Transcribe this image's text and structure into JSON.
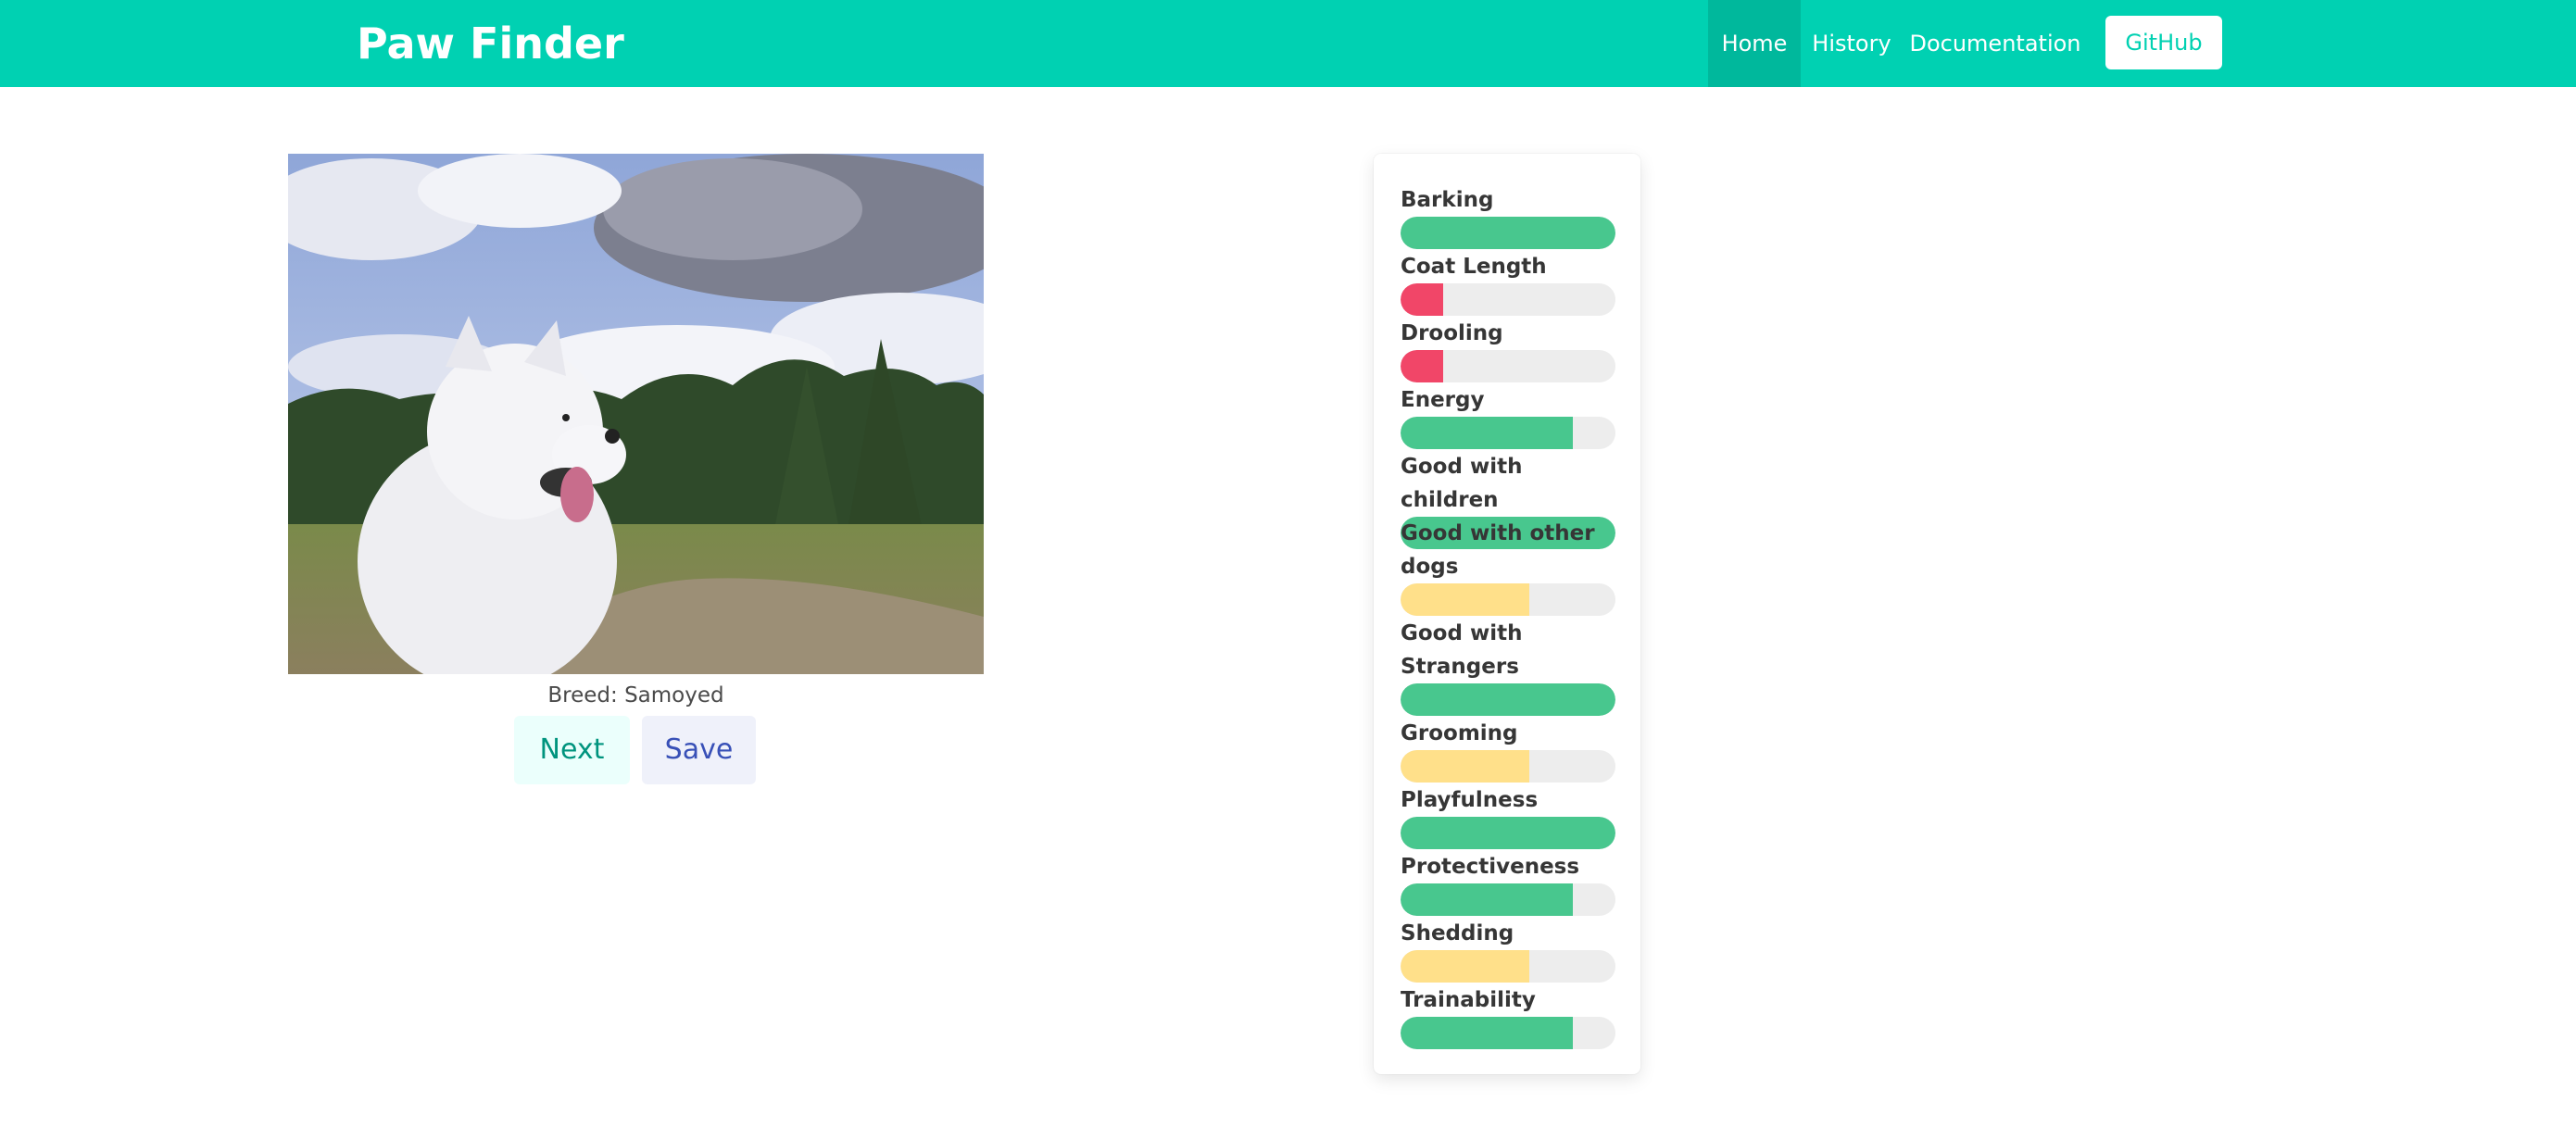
{
  "navbar": {
    "brand": "Paw Finder",
    "items": [
      {
        "label": "Home"
      },
      {
        "label": "History"
      },
      {
        "label": "Documentation"
      }
    ],
    "github_label": "GitHub",
    "color": "#00d1b2"
  },
  "main": {
    "breed_text": "Breed: Samoyed",
    "next_label": "Next",
    "save_label": "Save"
  },
  "traits": [
    {
      "label": "Barking",
      "value": 1.0,
      "color": "#48c78e"
    },
    {
      "label": "Coat Length",
      "value": 0.2,
      "color": "#f14668"
    },
    {
      "label": "Drooling",
      "value": 0.2,
      "color": "#f14668"
    },
    {
      "label": "Energy",
      "value": 0.8,
      "color": "#48c78e"
    },
    {
      "label": "Good with children",
      "value": 1.0,
      "color": "#48c78e"
    },
    {
      "label": "Good with other dogs",
      "value": 0.6,
      "color": "#ffe08a"
    },
    {
      "label": "Good with Strangers",
      "value": 1.0,
      "color": "#48c78e"
    },
    {
      "label": "Grooming",
      "value": 0.6,
      "color": "#ffe08a"
    },
    {
      "label": "Playfulness",
      "value": 1.0,
      "color": "#48c78e"
    },
    {
      "label": "Protectiveness",
      "value": 0.8,
      "color": "#48c78e"
    },
    {
      "label": "Shedding",
      "value": 0.6,
      "color": "#ffe08a"
    },
    {
      "label": "Trainability",
      "value": 0.8,
      "color": "#48c78e"
    }
  ]
}
